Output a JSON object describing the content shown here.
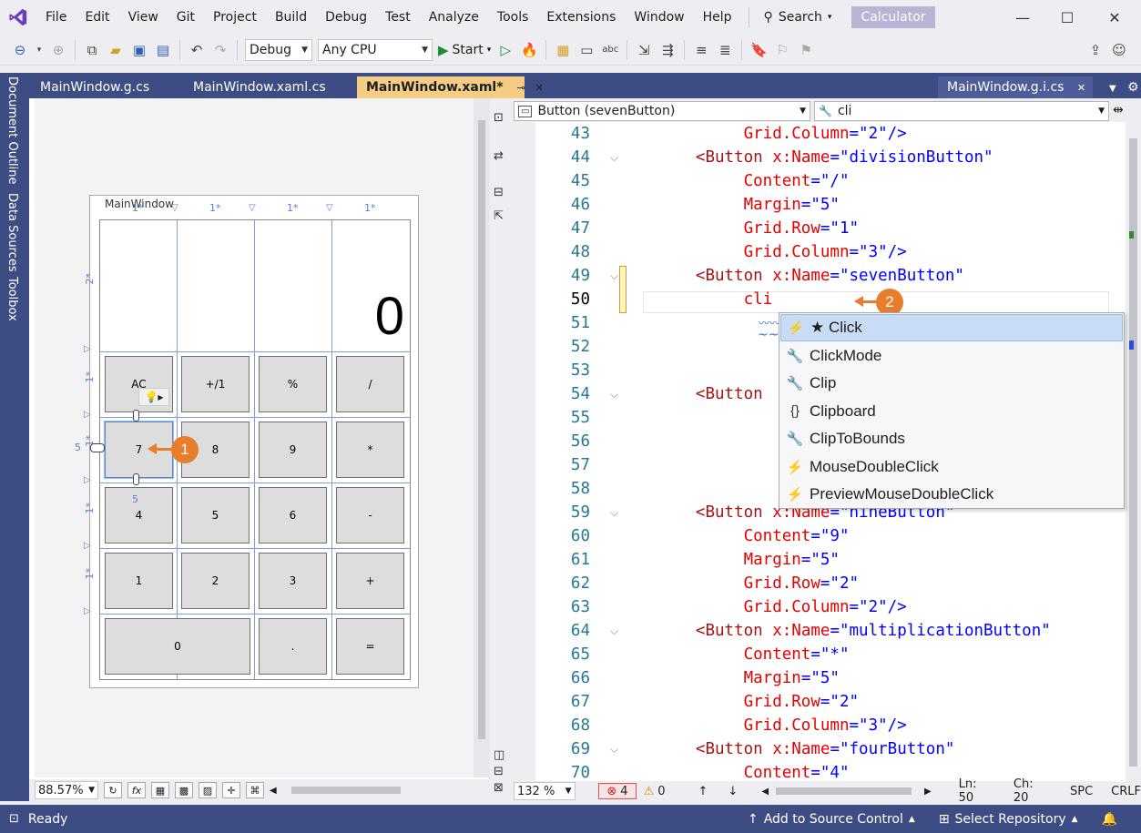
{
  "menu": {
    "items": [
      "File",
      "Edit",
      "View",
      "Git",
      "Project",
      "Build",
      "Debug",
      "Test",
      "Analyze",
      "Tools",
      "Extensions",
      "Window",
      "Help"
    ],
    "search_label": "Search",
    "solution_name": "Calculator"
  },
  "toolbar": {
    "config": "Debug",
    "platform": "Any CPU",
    "start_label": "Start"
  },
  "side_tabs": [
    "Document Outline",
    "Data Sources",
    "Toolbox"
  ],
  "tabs": {
    "left": [
      "MainWindow.g.cs",
      "MainWindow.xaml.cs"
    ],
    "active": "MainWindow.xaml*",
    "right": "MainWindow.g.i.cs"
  },
  "designer": {
    "window_title": "MainWindow",
    "display_value": "0",
    "zoom": "88.57%",
    "col_labels": [
      "1*",
      "1*",
      "1*",
      "1*"
    ],
    "row_labels": [
      "2*",
      "1*",
      "1*",
      "1*",
      "1*"
    ],
    "margin_label": "5",
    "buttons": [
      [
        "AC",
        "+/1",
        "%",
        "/"
      ],
      [
        "7",
        "8",
        "9",
        "*"
      ],
      [
        "4",
        "5",
        "6",
        "-"
      ],
      [
        "1",
        "2",
        "3",
        "+"
      ],
      [
        "0",
        ".",
        "="
      ]
    ],
    "callout_1": "1"
  },
  "editor": {
    "element_combo": "Button (sevenButton)",
    "member_combo": "cli",
    "zoom": "132 %",
    "errors": "4",
    "warnings": "0",
    "ln": "Ln: 50",
    "ch": "Ch: 20",
    "spc": "SPC",
    "crlf": "CRLF",
    "callout_2": "2",
    "lines": [
      {
        "n": "43",
        "parts": [
          [
            "",
            "            "
          ],
          [
            "attr",
            "Grid.Column"
          ],
          [
            "val",
            "=\"2\"/>"
          ]
        ]
      },
      {
        "n": "44",
        "parts": [
          [
            "",
            "       "
          ],
          [
            "tag",
            "<Button "
          ],
          [
            "attr",
            "x:Name"
          ],
          [
            "val",
            "=\"divisionButton\""
          ]
        ]
      },
      {
        "n": "45",
        "parts": [
          [
            "",
            "            "
          ],
          [
            "attr",
            "Content"
          ],
          [
            "val",
            "=\"/\""
          ]
        ]
      },
      {
        "n": "46",
        "parts": [
          [
            "",
            "            "
          ],
          [
            "attr",
            "Margin"
          ],
          [
            "val",
            "=\"5\""
          ]
        ]
      },
      {
        "n": "47",
        "parts": [
          [
            "",
            "            "
          ],
          [
            "attr",
            "Grid.Row"
          ],
          [
            "val",
            "=\"1\""
          ]
        ]
      },
      {
        "n": "48",
        "parts": [
          [
            "",
            "            "
          ],
          [
            "attr",
            "Grid.Column"
          ],
          [
            "val",
            "=\"3\"/>"
          ]
        ]
      },
      {
        "n": "49",
        "parts": [
          [
            "",
            "       "
          ],
          [
            "tag",
            "<Button "
          ],
          [
            "attr",
            "x:Name"
          ],
          [
            "val",
            "=\"sevenButton\""
          ]
        ]
      },
      {
        "n": "50",
        "parts": [
          [
            "",
            "            "
          ],
          [
            "attr",
            "cli"
          ]
        ]
      },
      {
        "n": "51",
        "parts": []
      },
      {
        "n": "52",
        "parts": []
      },
      {
        "n": "53",
        "parts": []
      },
      {
        "n": "54",
        "parts": [
          [
            "",
            "       "
          ],
          [
            "tag",
            "<Button"
          ]
        ]
      },
      {
        "n": "55",
        "parts": []
      },
      {
        "n": "56",
        "parts": []
      },
      {
        "n": "57",
        "parts": []
      },
      {
        "n": "58",
        "parts": []
      },
      {
        "n": "59",
        "parts": [
          [
            "",
            "       "
          ],
          [
            "tag",
            "<Button "
          ],
          [
            "attr",
            "x:Name"
          ],
          [
            "val",
            "=\"nineButton\""
          ]
        ]
      },
      {
        "n": "60",
        "parts": [
          [
            "",
            "            "
          ],
          [
            "attr",
            "Content"
          ],
          [
            "val",
            "=\"9\""
          ]
        ]
      },
      {
        "n": "61",
        "parts": [
          [
            "",
            "            "
          ],
          [
            "attr",
            "Margin"
          ],
          [
            "val",
            "=\"5\""
          ]
        ]
      },
      {
        "n": "62",
        "parts": [
          [
            "",
            "            "
          ],
          [
            "attr",
            "Grid.Row"
          ],
          [
            "val",
            "=\"2\""
          ]
        ]
      },
      {
        "n": "63",
        "parts": [
          [
            "",
            "            "
          ],
          [
            "attr",
            "Grid.Column"
          ],
          [
            "val",
            "=\"2\"/>"
          ]
        ]
      },
      {
        "n": "64",
        "parts": [
          [
            "",
            "       "
          ],
          [
            "tag",
            "<Button "
          ],
          [
            "attr",
            "x:Name"
          ],
          [
            "val",
            "=\"multiplicationButton\""
          ]
        ]
      },
      {
        "n": "65",
        "parts": [
          [
            "",
            "            "
          ],
          [
            "attr",
            "Content"
          ],
          [
            "val",
            "=\"*\""
          ]
        ]
      },
      {
        "n": "66",
        "parts": [
          [
            "",
            "            "
          ],
          [
            "attr",
            "Margin"
          ],
          [
            "val",
            "=\"5\""
          ]
        ]
      },
      {
        "n": "67",
        "parts": [
          [
            "",
            "            "
          ],
          [
            "attr",
            "Grid.Row"
          ],
          [
            "val",
            "=\"2\""
          ]
        ]
      },
      {
        "n": "68",
        "parts": [
          [
            "",
            "            "
          ],
          [
            "attr",
            "Grid.Column"
          ],
          [
            "val",
            "=\"3\"/>"
          ]
        ]
      },
      {
        "n": "69",
        "parts": [
          [
            "",
            "       "
          ],
          [
            "tag",
            "<Button "
          ],
          [
            "attr",
            "x:Name"
          ],
          [
            "val",
            "=\"fourButton\""
          ]
        ]
      },
      {
        "n": "70",
        "parts": [
          [
            "",
            "            "
          ],
          [
            "attr",
            "Content"
          ],
          [
            "val",
            "=\"4\""
          ]
        ]
      }
    ]
  },
  "autocomplete": {
    "items": [
      {
        "icon": "event-icon",
        "glyph": "⚡",
        "label": "★ Click"
      },
      {
        "icon": "property-icon",
        "glyph": "🔧",
        "label": "ClickMode"
      },
      {
        "icon": "property-icon",
        "glyph": "🔧",
        "label": "Clip"
      },
      {
        "icon": "namespace-icon",
        "glyph": "{}",
        "label": "Clipboard"
      },
      {
        "icon": "property-icon",
        "glyph": "🔧",
        "label": "ClipToBounds"
      },
      {
        "icon": "event-icon",
        "glyph": "⚡",
        "label": "MouseDoubleClick"
      },
      {
        "icon": "event-icon",
        "glyph": "⚡",
        "label": "PreviewMouseDoubleClick"
      }
    ]
  },
  "status": {
    "ready": "Ready",
    "source_control": "Add to Source Control",
    "repository": "Select Repository"
  },
  "colors": {
    "accent": "#3e4c84",
    "active_tab": "#f5cc84",
    "callout": "#e87d2c"
  }
}
